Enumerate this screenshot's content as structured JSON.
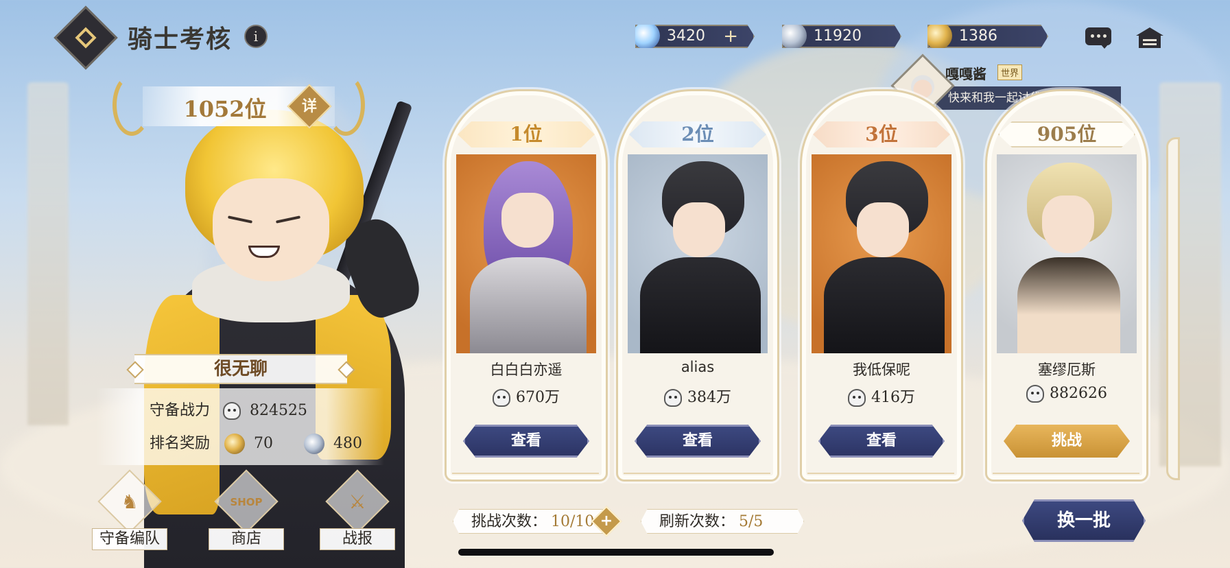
{
  "header": {
    "title": "骑士考核",
    "info_label": "i",
    "resources": [
      {
        "name": "crystal",
        "value": "3420",
        "has_plus": true,
        "plus_label": "+"
      },
      {
        "name": "silver-medal",
        "value": "11920"
      },
      {
        "name": "gold-medal",
        "value": "1386"
      }
    ]
  },
  "chat": {
    "name": "嘎嘎酱",
    "channel": "世界",
    "message": "快来和我一起讨伐诺尔吧点击..."
  },
  "player": {
    "rank": "1052位",
    "detail_label": "详",
    "motto": "很无聊",
    "defense_label": "守备战力",
    "defense_value": "824525",
    "reward_label": "排名奖励",
    "reward_gold": "70",
    "reward_silver": "480"
  },
  "left_buttons": [
    {
      "label": "守备编队",
      "icon": "knight-chess-icon",
      "glyph": "♞"
    },
    {
      "label": "商店",
      "icon": "shop-icon",
      "glyph": "SHOP"
    },
    {
      "label": "战报",
      "icon": "battle-report-icon",
      "glyph": "⚔"
    }
  ],
  "opponents": [
    {
      "rank": "1位",
      "name": "白白白亦遥",
      "power": "670万",
      "button": "查看",
      "tier": "gold"
    },
    {
      "rank": "2位",
      "name": "alias",
      "power": "384万",
      "button": "查看",
      "tier": "silver"
    },
    {
      "rank": "3位",
      "name": "我低保呢",
      "power": "416万",
      "button": "查看",
      "tier": "bronze"
    },
    {
      "rank": "905位",
      "name": "塞缪厄斯",
      "power": "882626",
      "button": "挑战",
      "tier": "plain"
    }
  ],
  "footer": {
    "challenge_label": "挑战次数：",
    "challenge_value": "10/10",
    "refresh_count_label": "刷新次数：",
    "refresh_count_value": "5/5",
    "refresh_button": "换一批"
  },
  "colors": {
    "navy": "#2e3552",
    "gold": "#c99235",
    "cream": "#f7f3ea"
  }
}
